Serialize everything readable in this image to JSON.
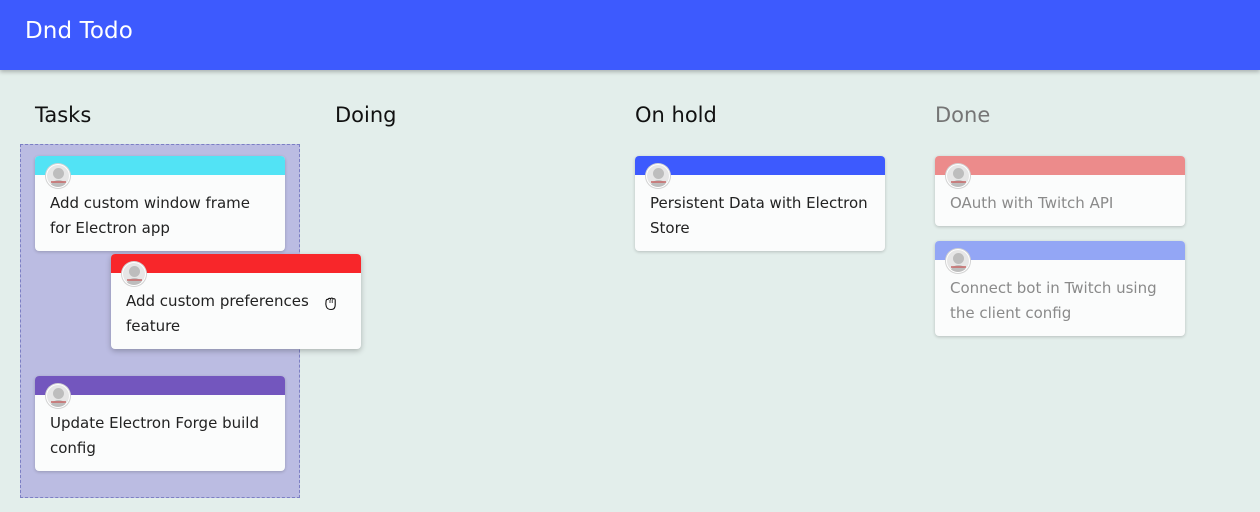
{
  "app": {
    "title": "Dnd Todo",
    "accent_color": "#3d5afe"
  },
  "columns": [
    {
      "title": "Tasks",
      "cards": [
        {
          "text": "Add custom window frame for Electron app",
          "color": "#52e3f5"
        },
        {
          "text": "Add custom preferences feature",
          "color": "#f8262a",
          "state": "dragging"
        },
        {
          "text": "Update Electron Forge build config",
          "color": "#7356be"
        }
      ]
    },
    {
      "title": "Doing",
      "cards": []
    },
    {
      "title": "On hold",
      "cards": [
        {
          "text": "Persistent Data with Electron Store",
          "color": "#3d5afe"
        }
      ]
    },
    {
      "title": "Done",
      "cards": [
        {
          "text": "OAuth with Twitch API",
          "color": "#ec8b8b"
        },
        {
          "text": "Connect bot in Twitch using the client config",
          "color": "#93a6f5"
        }
      ]
    }
  ],
  "icons": {
    "avatar": "avatar-icon",
    "cursor": "grab-hand-cursor-icon"
  }
}
